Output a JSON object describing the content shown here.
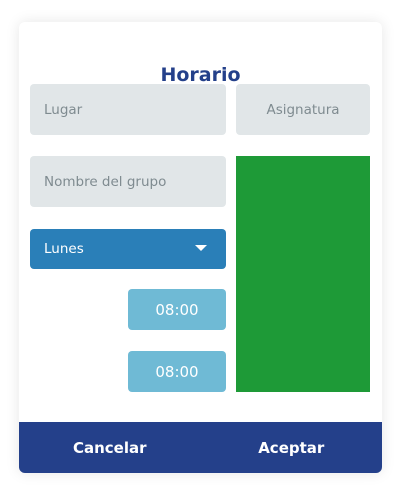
{
  "dialog": {
    "title": "Horario",
    "lugar_placeholder": "Lugar",
    "asignatura_placeholder": "Asignatura",
    "grupo_placeholder": "Nombre del grupo",
    "day_select": {
      "selected": "Lunes"
    },
    "start_time": "08:00",
    "end_time": "08:00",
    "color": "#1e9a37",
    "cancel_label": "Cancelar",
    "accept_label": "Aceptar"
  },
  "colors": {
    "accent": "#24408a",
    "select_bg": "#2a7fb8",
    "time_bg": "#6fbad5",
    "field_bg": "#e1e6e8"
  }
}
